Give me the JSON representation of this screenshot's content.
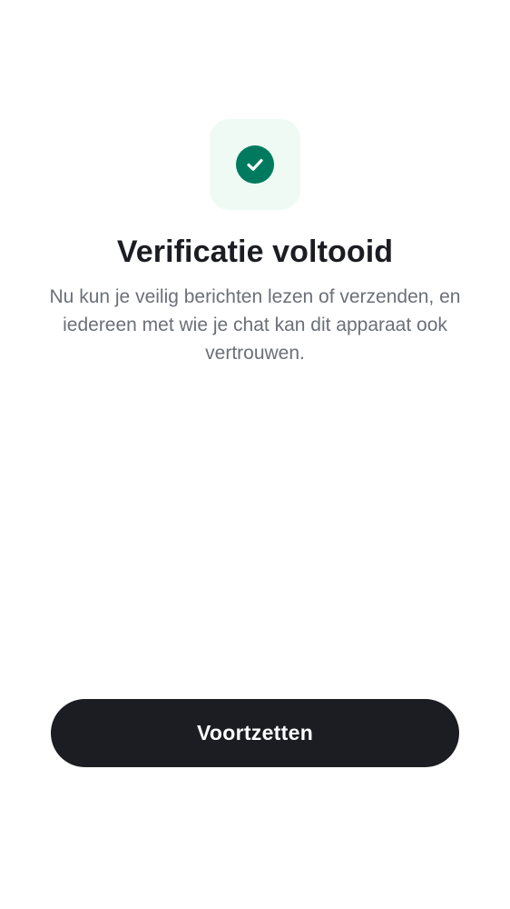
{
  "colors": {
    "background": "#ffffff",
    "icon_tile_bg": "#effaf4",
    "success_green": "#007a5e",
    "button_bg": "#1b1d22",
    "title_text": "#1b1d22",
    "body_text": "#6b6f77"
  },
  "status_icon": {
    "name": "check-circle-icon"
  },
  "verification": {
    "title": "Verificatie voltooid",
    "description": "Nu kun je veilig berichten lezen of verzenden, en iedereen met wie je chat kan dit apparaat ook vertrouwen."
  },
  "actions": {
    "continue_label": "Voortzetten"
  }
}
